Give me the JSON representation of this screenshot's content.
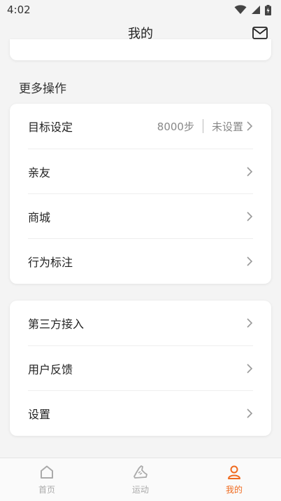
{
  "status_bar": {
    "time": "4:02"
  },
  "header": {
    "title": "我的"
  },
  "colors": {
    "accent": "#ef6a1f",
    "inactive": "#aaaaaa"
  },
  "more_section": {
    "title": "更多操作",
    "items": [
      {
        "label": "目标设定",
        "value": "8000步",
        "extra": "未设置"
      },
      {
        "label": "亲友"
      },
      {
        "label": "商城"
      },
      {
        "label": "行为标注"
      }
    ]
  },
  "settings_section": {
    "items": [
      {
        "label": "第三方接入"
      },
      {
        "label": "用户反馈"
      },
      {
        "label": "设置"
      }
    ]
  },
  "bottom_nav": {
    "items": [
      {
        "label": "首页",
        "icon": "home-icon",
        "active": false
      },
      {
        "label": "运动",
        "icon": "shoe-icon",
        "active": false
      },
      {
        "label": "我的",
        "icon": "person-icon",
        "active": true
      }
    ]
  }
}
